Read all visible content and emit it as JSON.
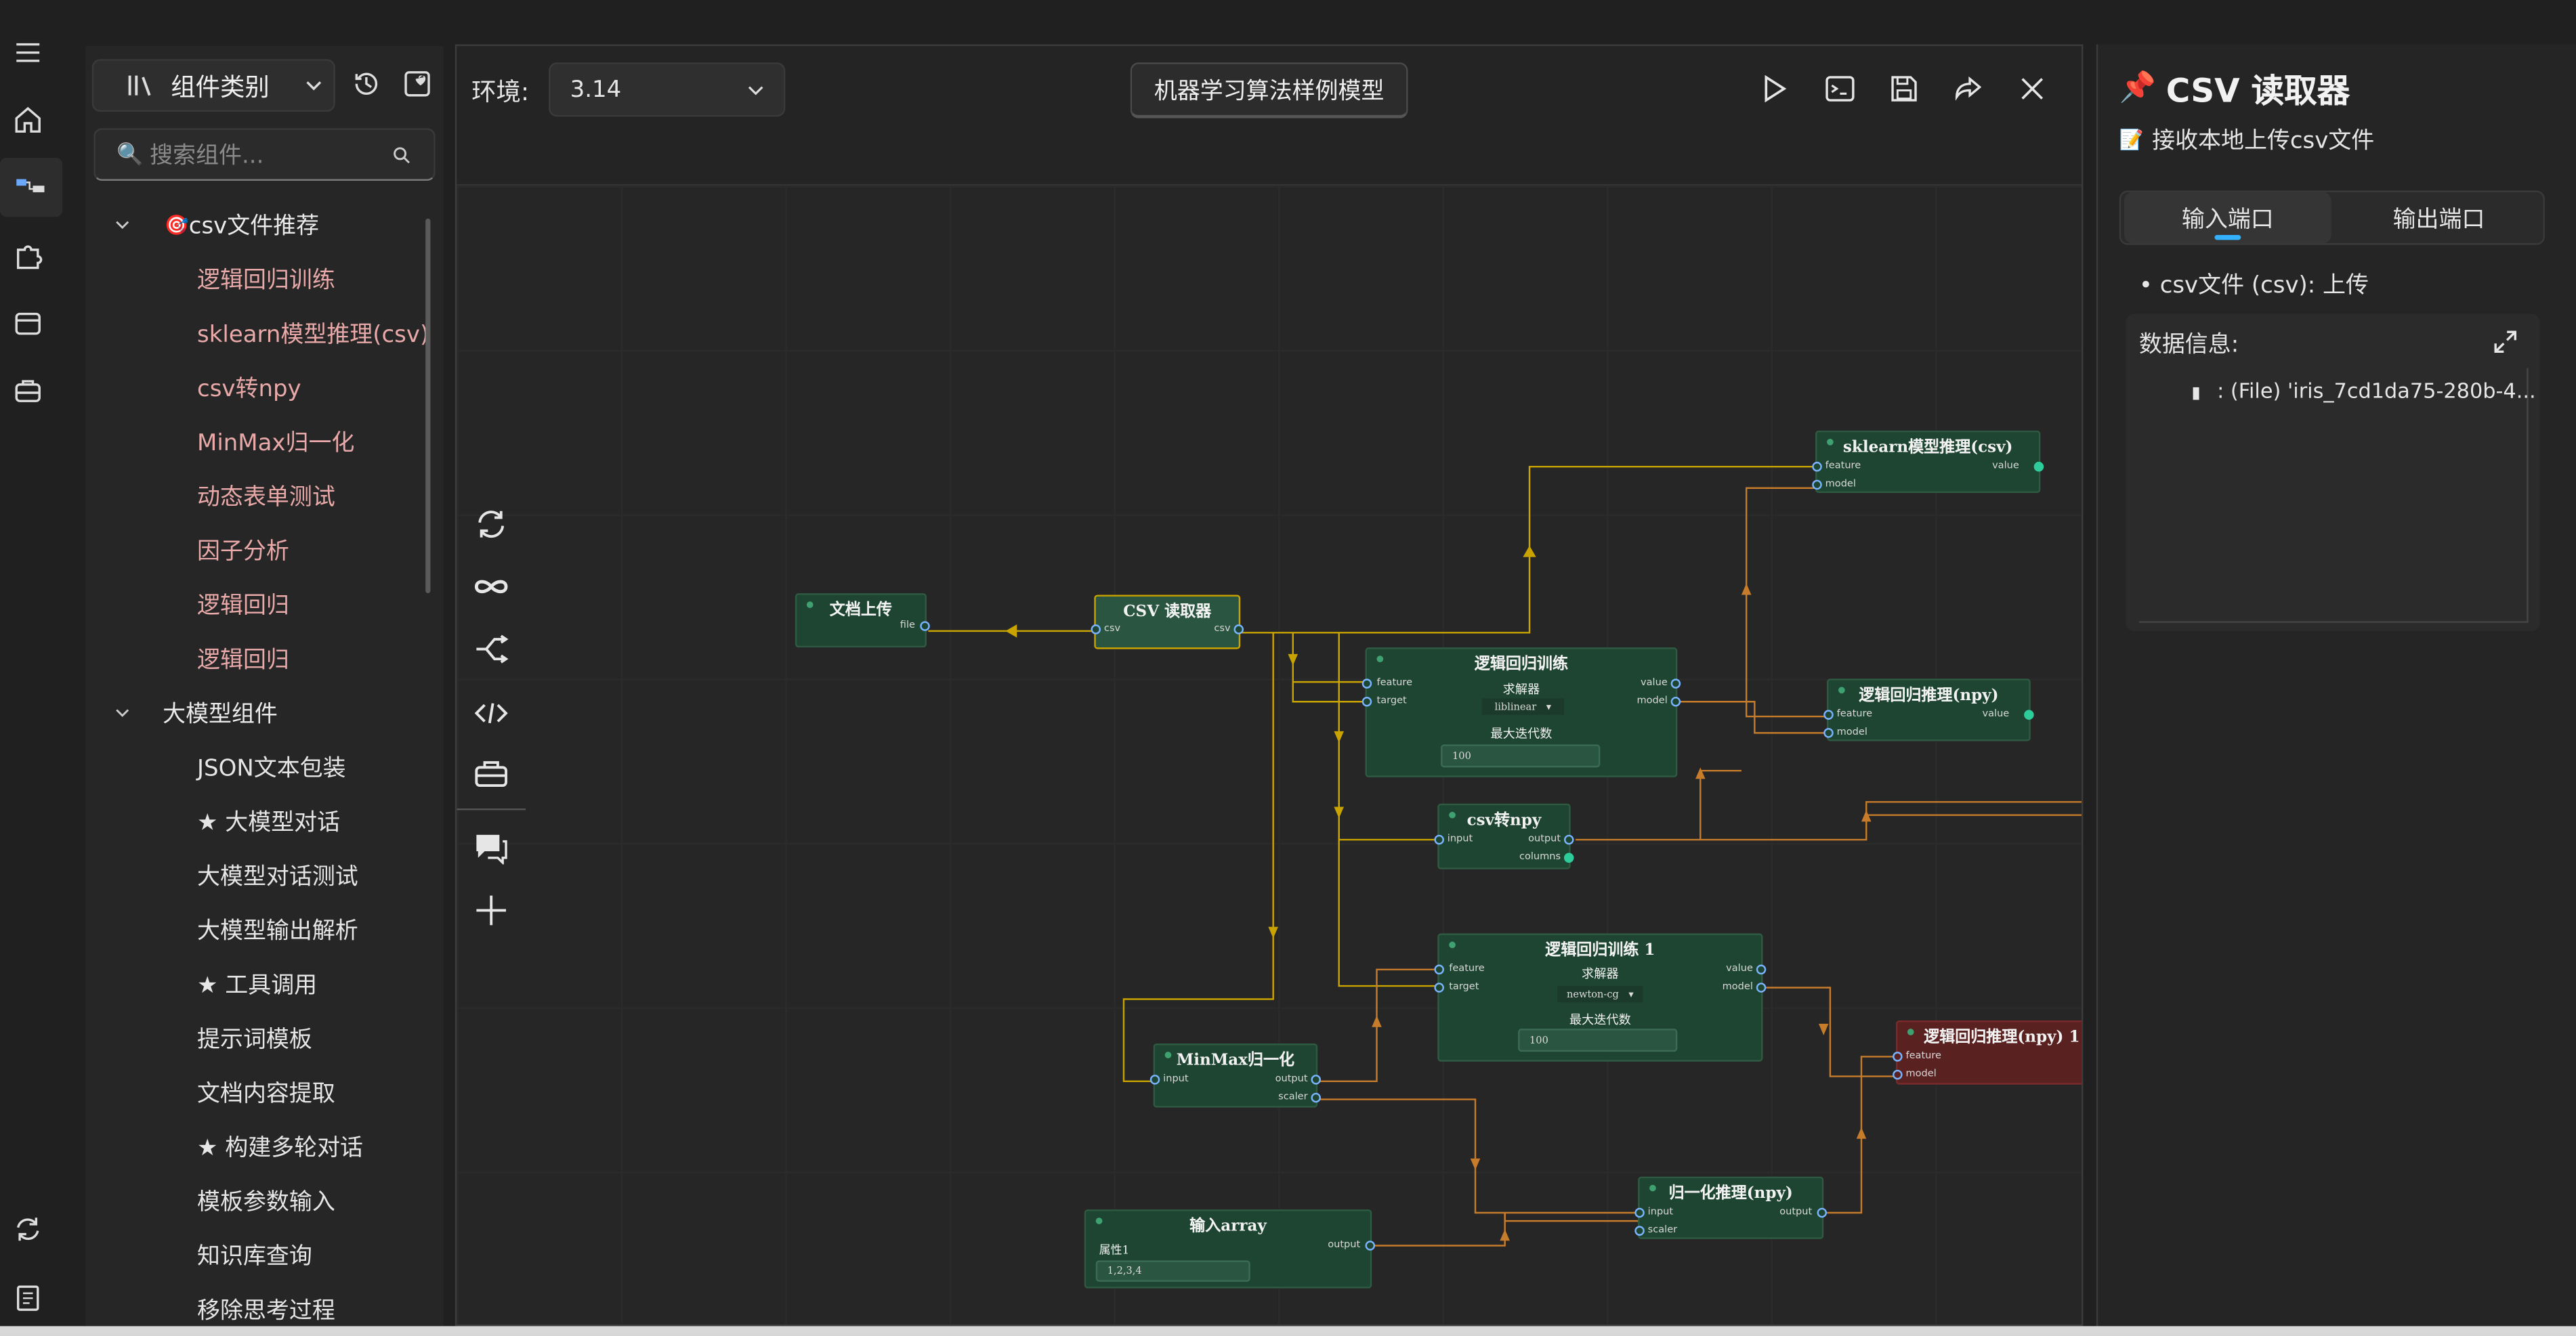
{
  "sidebar": {
    "category_label": "组件类别",
    "search_placeholder": "搜索组件...",
    "groups": [
      {
        "label": "csv文件推荐",
        "items": [
          "逻辑回归训练",
          "sklearn模型推理(csv)",
          "csv转npy",
          "MinMax归一化",
          "动态表单测试",
          "因子分析",
          "逻辑回归",
          "逻辑回归"
        ]
      },
      {
        "label": "大模型组件",
        "items": [
          "JSON文本包装",
          "★ 大模型对话",
          "大模型对话测试",
          "大模型输出解析",
          "★ 工具调用",
          "提示词模板",
          "文档内容提取",
          "★ 构建多轮对话",
          "模板参数输入",
          "知识库查询",
          "移除思考过程"
        ]
      }
    ]
  },
  "toolbar": {
    "env_label": "环境:",
    "env_value": "3.14",
    "flow_title": "机器学习算法样例模型"
  },
  "nodes": {
    "upload": {
      "title": "文档上传",
      "out": "file"
    },
    "csv_reader": {
      "title": "CSV 读取器",
      "in": "csv",
      "out": "csv"
    },
    "lr_train": {
      "title": "逻辑回归训练",
      "feature": "feature",
      "target": "target",
      "value": "value",
      "model": "model",
      "solver_label": "求解器",
      "solver": "liblinear",
      "iter_label": "最大迭代数",
      "iter": "100"
    },
    "sk_infer": {
      "title": "sklearn模型推理(csv)",
      "feature": "feature",
      "model": "model",
      "value": "value"
    },
    "lr_infer": {
      "title": "逻辑回归推理(npy)",
      "feature": "feature",
      "model": "model",
      "value": "value"
    },
    "csv2npy": {
      "title": "csv转npy",
      "input": "input",
      "output": "output",
      "columns": "columns"
    },
    "lr_train1": {
      "title": "逻辑回归训练 1",
      "feature": "feature",
      "target": "target",
      "value": "value",
      "model": "model",
      "solver_label": "求解器",
      "solver": "newton-cg",
      "iter_label": "最大迭代数",
      "iter": "100"
    },
    "minmax": {
      "title": "MinMax归一化",
      "input": "input",
      "output": "output",
      "scaler": "scaler"
    },
    "lr_infer_red": {
      "title": "逻辑回归推理(npy) 1",
      "feature": "feature",
      "model": "model"
    },
    "norm_infer": {
      "title": "归一化推理(npy)",
      "input": "input",
      "scaler": "scaler",
      "output": "output"
    },
    "input_array": {
      "title": "输入array",
      "attr_label": "属性1",
      "attr_value": "1,2,3,4",
      "output": "output"
    }
  },
  "right_panel": {
    "title": "CSV 读取器",
    "subtitle": "接收本地上传csv文件",
    "tab_input": "输入端口",
    "tab_output": "输出端口",
    "port_line": "• csv文件 (csv): 上传",
    "data_title": "数据信息:",
    "data_item": ": (File) 'iris_7cd1da75-280b-4..."
  },
  "colors": {
    "accent": "#33b1ff",
    "edge_yellow": "#c9a400",
    "edge_orange": "#c67c2a",
    "node_green": "#1d4532",
    "node_red": "#5a2121"
  }
}
